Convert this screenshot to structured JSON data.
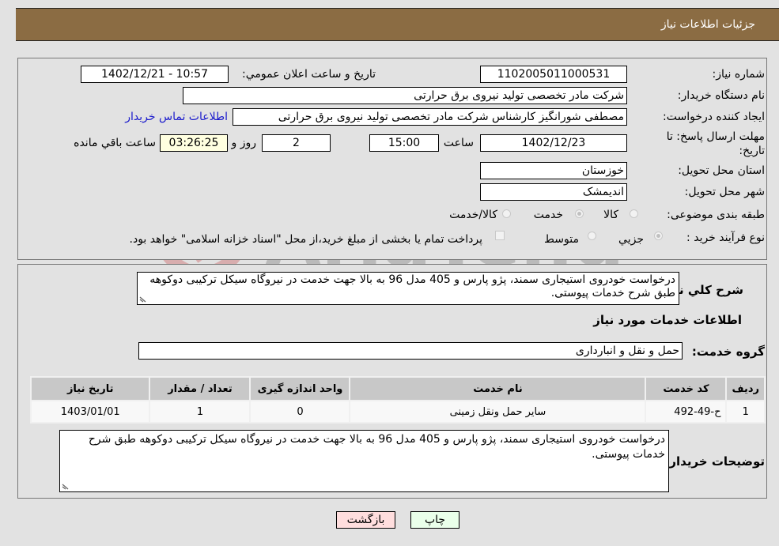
{
  "header": {
    "title": "جزئیات اطلاعات نیاز"
  },
  "details": {
    "need_number_label": "شماره نیاز:",
    "need_number": "1102005011000531",
    "announce_label": "تاریخ و ساعت اعلان عمومي:",
    "announce_value": "1402/12/21 - 10:57",
    "buyer_org_label": "نام دستگاه خريدار:",
    "buyer_org": "شرکت مادر تخصصی تولید نیروی برق حرارتی",
    "creator_label": "ایجاد کننده درخواست:",
    "creator": "مصطفی شورانگیز کارشناس شرکت مادر تخصصی تولید نیروی برق حرارتی",
    "contact_link": "اطلاعات تماس خریدار",
    "deadline_label_line1": "مهلت ارسال پاسخ: تا",
    "deadline_label_line2": "تاریخ:",
    "deadline_date": "1402/12/23",
    "time_label": "ساعت",
    "deadline_time": "15:00",
    "days_value": "2",
    "days_label": "روز و",
    "remaining_time": "03:26:25",
    "remaining_label": "ساعت باقي مانده",
    "province_label": "استان محل تحویل:",
    "province": "خوزستان",
    "city_label": "شهر محل تحویل:",
    "city": "اندیمشک",
    "category_label": "طبقه بندی موضوعی:",
    "category_options": [
      {
        "label": "کالا",
        "checked": false
      },
      {
        "label": "خدمت",
        "checked": true
      },
      {
        "label": "کالا/خدمت",
        "checked": false
      }
    ],
    "process_label": "نوع فرآیند خرید :",
    "process_options": [
      {
        "label": "جزيي",
        "checked": true
      },
      {
        "label": "متوسط",
        "checked": false
      }
    ],
    "treasury_note": "پرداخت تمام یا بخشی از مبلغ خرید،از محل \"اسناد خزانه اسلامی\" خواهد بود.",
    "treasury_checked": false
  },
  "description": {
    "label": "شرح کلي نياز:",
    "text": "درخواست خودروی استیجاری سمند، پژو پارس و 405 مدل 96 به بالا جهت خدمت در نیروگاه سیکل ترکیبی دوکوهه طبق شرح خدمات پیوستی."
  },
  "services": {
    "section_title": "اطلاعات خدمات مورد نياز",
    "group_label": "گروه خدمت:",
    "group_value": "حمل و نقل و انبارداری",
    "table": {
      "headers": [
        "رديف",
        "کد خدمت",
        "نام خدمت",
        "واحد اندازه گيری",
        "تعداد / مقدار",
        "تاريخ نياز"
      ],
      "rows": [
        [
          "1",
          "ح-49-492",
          "سایر حمل ونقل زمینی",
          "0",
          "1",
          "1403/01/01"
        ]
      ]
    }
  },
  "buyer_notes": {
    "label": "توضيحات خريدار:",
    "text": "درخواست خودروی استیجاری سمند، پژو پارس و 405 مدل 96 به بالا جهت خدمت در نیروگاه سیکل ترکیبی دوکوهه طبق شرح خدمات پیوستی."
  },
  "buttons": {
    "print": "چاپ",
    "back": "بازگشت"
  },
  "colors": {
    "header_bg": "#8b6c43",
    "print_bg": "#eaffea",
    "back_bg": "#ffdede",
    "link": "#1a1acc"
  }
}
